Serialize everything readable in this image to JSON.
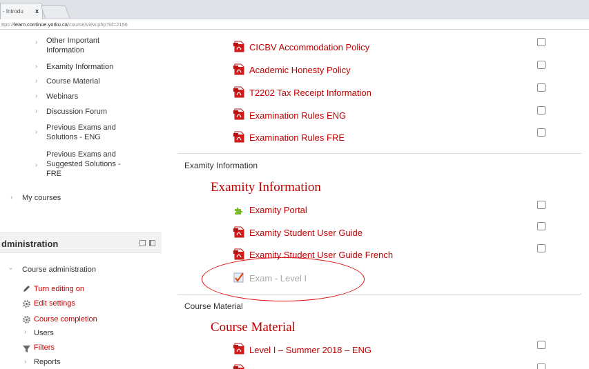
{
  "browser": {
    "tab_label": "- Introdu",
    "tab_close": "x",
    "url_prefix": "ttps://",
    "url_host": "learn.continue.yorku.ca",
    "url_path": "/course/view.php?id=2156"
  },
  "nav": {
    "items": [
      {
        "label": "Other Important Information"
      },
      {
        "label": "Examity Information"
      },
      {
        "label": "Course Material"
      },
      {
        "label": "Webinars"
      },
      {
        "label": "Discussion Forum"
      },
      {
        "label": "Previous Exams and Solutions - ENG"
      },
      {
        "label": "Previous Exams and Suggested Solutions - FRE"
      }
    ],
    "my_courses": "My courses"
  },
  "administration": {
    "title": "dministration",
    "course_admin": "Course administration",
    "items": [
      {
        "label": "Turn editing on",
        "icon": "pencil-icon"
      },
      {
        "label": "Edit settings",
        "icon": "gear-icon"
      },
      {
        "label": "Course completion",
        "icon": "gear-icon"
      },
      {
        "label": "Users",
        "icon": "chevron-right-icon"
      },
      {
        "label": "Filters",
        "icon": "filter-icon"
      },
      {
        "label": "Reports",
        "icon": "chevron-right-icon"
      }
    ]
  },
  "policies": [
    {
      "label": "CICBV Accommodation Policy"
    },
    {
      "label": "Academic Honesty Policy"
    },
    {
      "label": "T2202 Tax Receipt Information"
    },
    {
      "label": "Examination Rules ENG"
    },
    {
      "label": "Examination Rules FRE"
    }
  ],
  "examity_section": {
    "small_title": "Examity Information",
    "big_title": "Examity Information",
    "items": [
      {
        "label": "Examity Portal",
        "icon": "puzzle-icon"
      },
      {
        "label": "Examity Student User Guide",
        "icon": "pdf-icon"
      },
      {
        "label": "Examity Student User Guide French",
        "icon": "pdf-icon"
      },
      {
        "label": "Exam - Level I",
        "icon": "quiz-icon"
      }
    ]
  },
  "course_material": {
    "small_title": "Course Material",
    "big_title": "Course Material",
    "items": [
      {
        "label": "Level I – Summer 2018 – ENG",
        "icon": "pdf-icon"
      }
    ]
  },
  "colors": {
    "link_red": "#c00000",
    "annotation_circle": "#e01010"
  }
}
